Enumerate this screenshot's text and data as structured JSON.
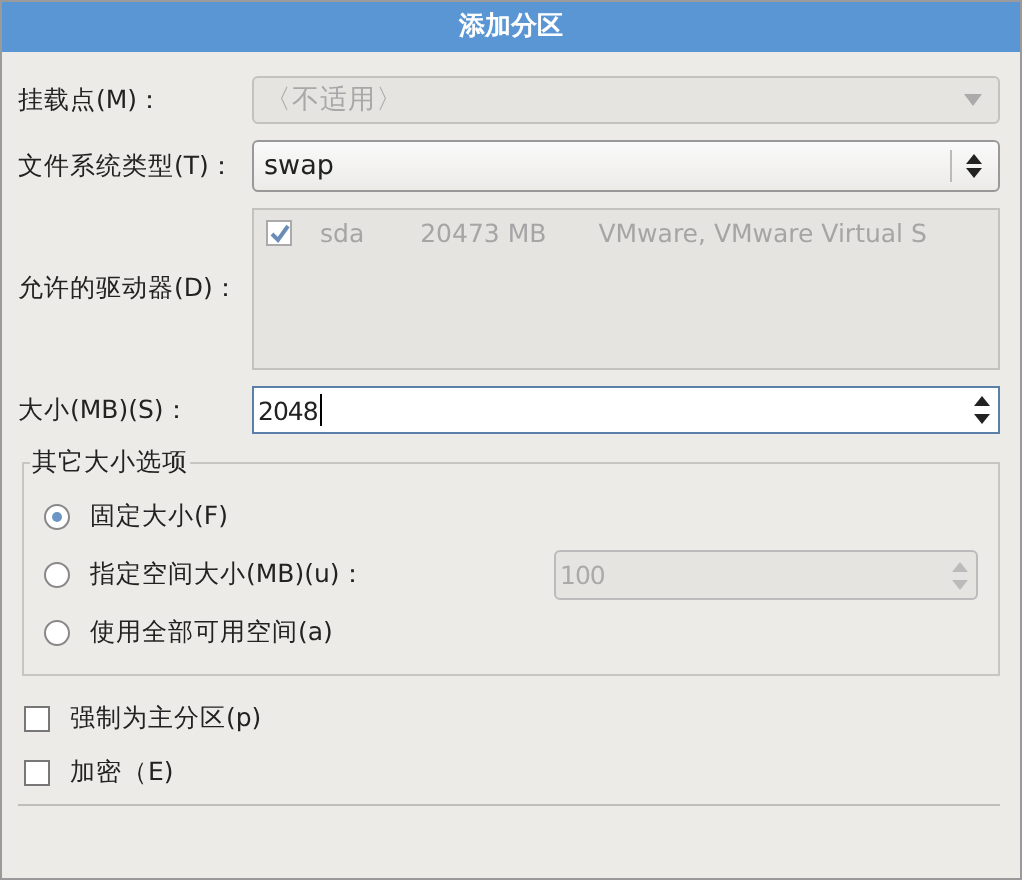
{
  "dialog": {
    "title": "添加分区"
  },
  "mount_point": {
    "label": "挂载点(M)：",
    "value": "〈不适用〉",
    "disabled": true
  },
  "fs_type": {
    "label": "文件系统类型(T)：",
    "value": "swap"
  },
  "drives": {
    "label": "允许的驱动器(D)：",
    "disabled": true,
    "items": [
      {
        "checked": true,
        "name": "sda",
        "size": "20473 MB",
        "model": "VMware, VMware Virtual S"
      }
    ]
  },
  "size": {
    "label": "大小(MB)(S)：",
    "value": "2048"
  },
  "size_options": {
    "title": "其它大小选项",
    "options": [
      {
        "label": "固定大小(F)",
        "selected": true
      },
      {
        "label": "指定空间大小(MB)(u)：",
        "selected": false,
        "field": {
          "value": "100",
          "disabled": true
        }
      },
      {
        "label": "使用全部可用空间(a)",
        "selected": false
      }
    ]
  },
  "checkboxes": [
    {
      "label": "强制为主分区(p)",
      "checked": false
    },
    {
      "label": "加密（E)",
      "checked": false
    }
  ]
}
